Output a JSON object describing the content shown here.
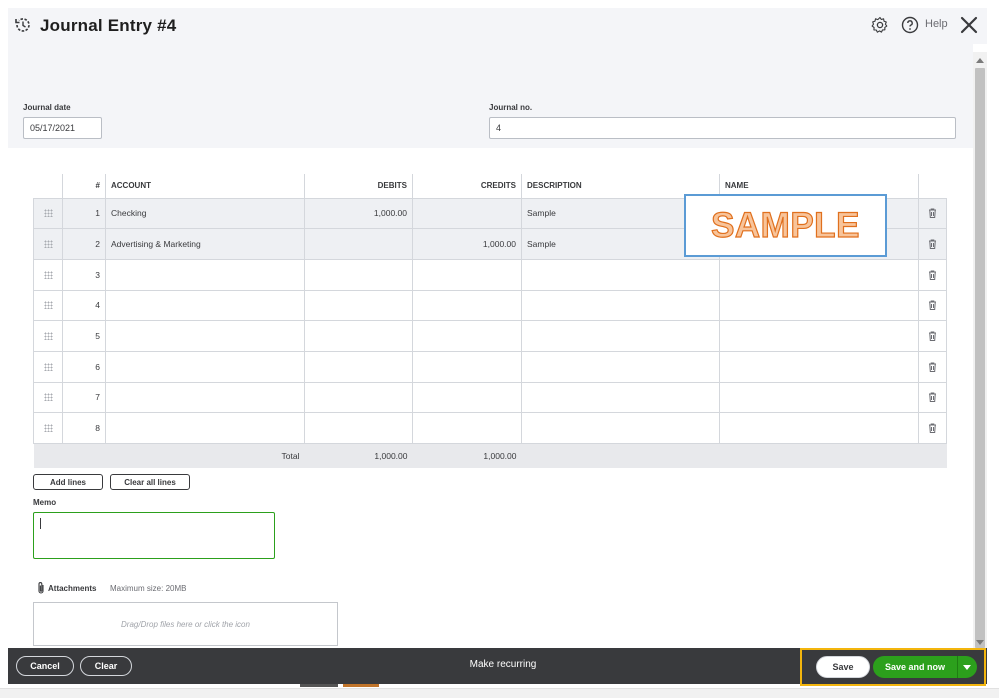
{
  "header": {
    "title": "Journal Entry #4",
    "help_label": "Help"
  },
  "form": {
    "journal_date_label": "Journal date",
    "journal_date_value": "05/17/2021",
    "journal_no_label": "Journal no.",
    "journal_no_value": "4"
  },
  "table": {
    "columns": [
      "#",
      "ACCOUNT",
      "DEBITS",
      "CREDITS",
      "DESCRIPTION",
      "NAME"
    ],
    "rows": [
      {
        "num": "1",
        "account": "Checking",
        "debit": "1,000.00",
        "credit": "",
        "description": "Sample",
        "name": ""
      },
      {
        "num": "2",
        "account": "Advertising & Marketing",
        "debit": "",
        "credit": "1,000.00",
        "description": "Sample",
        "name": ""
      },
      {
        "num": "3",
        "account": "",
        "debit": "",
        "credit": "",
        "description": "",
        "name": ""
      },
      {
        "num": "4",
        "account": "",
        "debit": "",
        "credit": "",
        "description": "",
        "name": ""
      },
      {
        "num": "5",
        "account": "",
        "debit": "",
        "credit": "",
        "description": "",
        "name": ""
      },
      {
        "num": "6",
        "account": "",
        "debit": "",
        "credit": "",
        "description": "",
        "name": ""
      },
      {
        "num": "7",
        "account": "",
        "debit": "",
        "credit": "",
        "description": "",
        "name": ""
      },
      {
        "num": "8",
        "account": "",
        "debit": "",
        "credit": "",
        "description": "",
        "name": ""
      }
    ],
    "total_label": "Total",
    "total_debits": "1,000.00",
    "total_credits": "1,000.00"
  },
  "sample_stamp": "SAMPLE",
  "buttons": {
    "add_lines": "Add lines",
    "clear_all_lines": "Clear all lines"
  },
  "memo": {
    "label": "Memo",
    "value": ""
  },
  "attachments": {
    "label": "Attachments",
    "max_size": "Maximum size: 20MB",
    "dropzone_text": "Drag/Drop files here or click the icon"
  },
  "footer": {
    "cancel": "Cancel",
    "clear": "Clear",
    "make_recurring": "Make recurring",
    "save": "Save",
    "save_and_new": "Save and now"
  },
  "colors": {
    "accent_green": "#2ca01c",
    "footer_bg": "#393a3d",
    "highlight": "#f3b50d",
    "stamp_orange": "#e0701e"
  },
  "icons": [
    "history-icon",
    "gear-icon",
    "help-icon",
    "close-icon",
    "drag-handle-icon",
    "trash-icon",
    "paperclip-icon",
    "dropdown-arrow-icon"
  ]
}
